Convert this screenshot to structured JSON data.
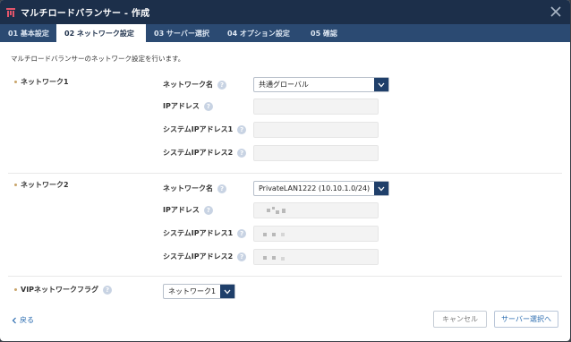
{
  "window": {
    "title": "マルチロードバランサー - 作成"
  },
  "tabs": [
    {
      "label": "01 基本設定"
    },
    {
      "label": "02 ネットワーク設定"
    },
    {
      "label": "03 サーバー選択"
    },
    {
      "label": "04 オプション設定"
    },
    {
      "label": "05 確認"
    }
  ],
  "description": "マルチロードバランサーのネットワーク設定を行います。",
  "network1": {
    "section_label": "ネットワーク1",
    "network_name_label": "ネットワーク名",
    "network_name_value": "共通グローバル",
    "ip_label": "IPアドレス",
    "sys_ip1_label": "システムIPアドレス1",
    "sys_ip2_label": "システムIPアドレス2"
  },
  "network2": {
    "section_label": "ネットワーク2",
    "network_name_label": "ネットワーク名",
    "network_name_value": "PrivateLAN1222 (10.10.1.0/24)",
    "ip_label": "IPアドレス",
    "sys_ip1_label": "システムIPアドレス1",
    "sys_ip2_label": "システムIPアドレス2"
  },
  "vip": {
    "label": "VIPネットワークフラグ",
    "value": "ネットワーク1"
  },
  "footer": {
    "back_label": "戻る",
    "cancel_label": "キャンセル",
    "next_label": "サーバー選択へ"
  },
  "help_glyph": "?",
  "colors": {
    "titlebar": "#1c2f4a",
    "tabbar": "#2b4a72",
    "accent": "#1f3f6a",
    "link": "#2b6cb0",
    "bullet": "#c9a46a"
  }
}
